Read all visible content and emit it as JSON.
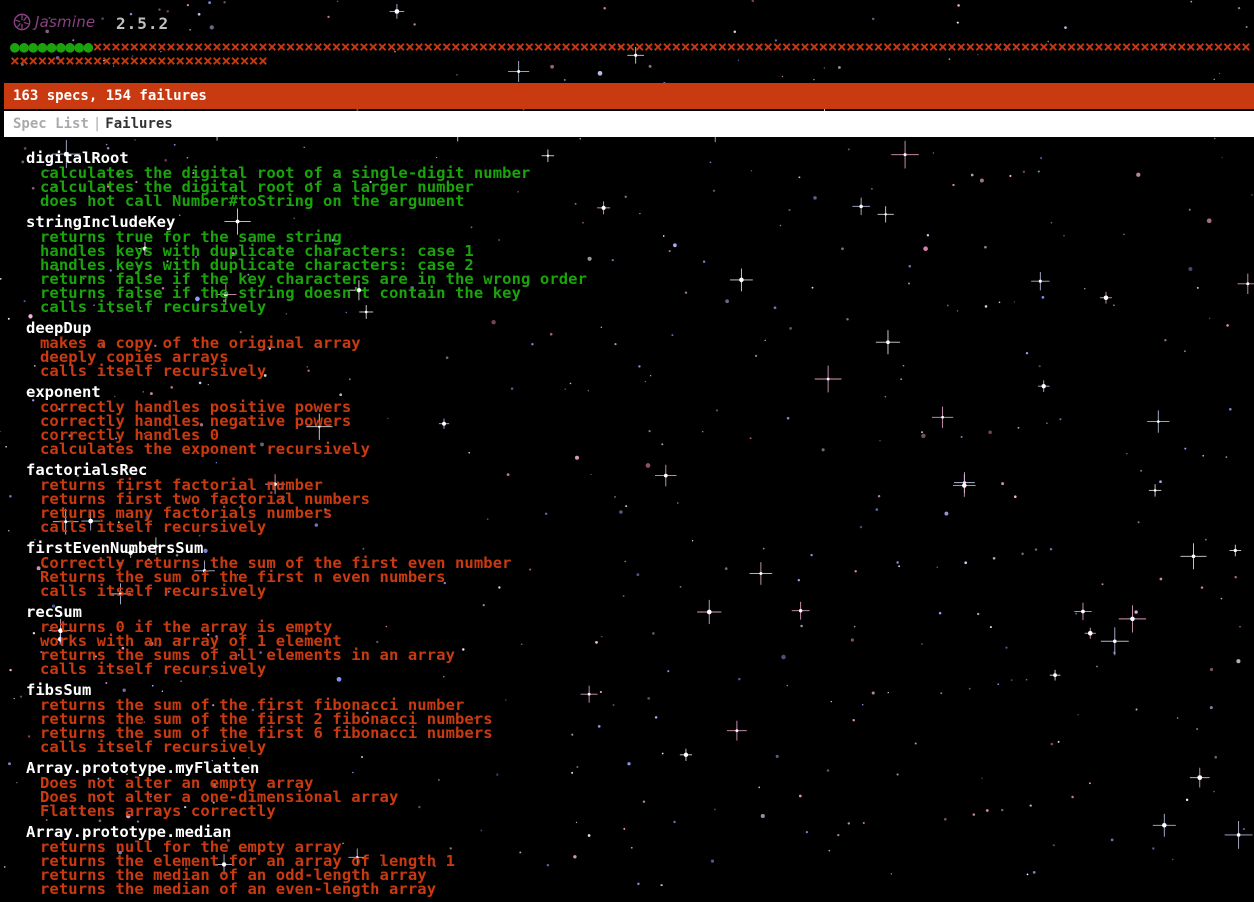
{
  "header": {
    "logo_text": "Jasmine",
    "version": "2.5.2"
  },
  "symbols": {
    "passed": 9,
    "failed": 154,
    "pass_glyph": "●",
    "fail_glyph": "×"
  },
  "summary": {
    "text": "163 specs, 154 failures"
  },
  "menu": {
    "spec_list": "Spec List",
    "separator": "|",
    "failures": "Failures"
  },
  "colors": {
    "passed": "#1aa30b",
    "failed": "#ca3a11",
    "suite": "#ffffff",
    "logo": "#8a4182"
  },
  "suites": [
    {
      "name": "digitalRoot",
      "specs": [
        {
          "text": "calculates the digital root of a single-digit number",
          "status": "passed"
        },
        {
          "text": "calculates the digital root of a larger number",
          "status": "passed"
        },
        {
          "text": "does not call Number#toString on the argument",
          "status": "passed"
        }
      ]
    },
    {
      "name": "stringIncludeKey",
      "specs": [
        {
          "text": "returns true for the same string",
          "status": "passed"
        },
        {
          "text": "handles keys with duplicate characters: case 1",
          "status": "passed"
        },
        {
          "text": "handles keys with duplicate characters: case 2",
          "status": "passed"
        },
        {
          "text": "returns false if the key characters are in the wrong order",
          "status": "passed"
        },
        {
          "text": "returns false if the string doesn't contain the key",
          "status": "passed"
        },
        {
          "text": "calls itself recursively",
          "status": "passed"
        }
      ]
    },
    {
      "name": "deepDup",
      "specs": [
        {
          "text": "makes a copy of the original array",
          "status": "failed"
        },
        {
          "text": "deeply copies arrays",
          "status": "failed"
        },
        {
          "text": "calls itself recursively",
          "status": "failed"
        }
      ]
    },
    {
      "name": "exponent",
      "specs": [
        {
          "text": "correctly handles positive powers",
          "status": "failed"
        },
        {
          "text": "correctly handles negative powers",
          "status": "failed"
        },
        {
          "text": "correctly handles 0",
          "status": "failed"
        },
        {
          "text": "calculates the exponent recursively",
          "status": "failed"
        }
      ]
    },
    {
      "name": "factorialsRec",
      "specs": [
        {
          "text": "returns first factorial number",
          "status": "failed"
        },
        {
          "text": "returns first two factorial numbers",
          "status": "failed"
        },
        {
          "text": "returns many factorials numbers",
          "status": "failed"
        },
        {
          "text": "calls itself recursively",
          "status": "failed"
        }
      ]
    },
    {
      "name": "firstEvenNumbersSum",
      "specs": [
        {
          "text": "Correctly returns the sum of the first even number",
          "status": "failed"
        },
        {
          "text": "Returns the sum of the first n even numbers",
          "status": "failed"
        },
        {
          "text": "calls itself recursively",
          "status": "failed"
        }
      ]
    },
    {
      "name": "recSum",
      "specs": [
        {
          "text": "returns 0 if the array is empty",
          "status": "failed"
        },
        {
          "text": "works with an array of 1 element",
          "status": "failed"
        },
        {
          "text": "returns the sums of all elements in an array",
          "status": "failed"
        },
        {
          "text": "calls itself recursively",
          "status": "failed"
        }
      ]
    },
    {
      "name": "fibsSum",
      "specs": [
        {
          "text": "returns the sum of the first fibonacci number",
          "status": "failed"
        },
        {
          "text": "returns the sum of the first 2 fibonacci numbers",
          "status": "failed"
        },
        {
          "text": "returns the sum of the first 6 fibonacci numbers",
          "status": "failed"
        },
        {
          "text": "calls itself recursively",
          "status": "failed"
        }
      ]
    },
    {
      "name": "Array.prototype.myFlatten",
      "specs": [
        {
          "text": "Does not alter an empty array",
          "status": "failed"
        },
        {
          "text": "Does not alter a one-dimensional array",
          "status": "failed"
        },
        {
          "text": "Flattens arrays correctly",
          "status": "failed"
        }
      ]
    },
    {
      "name": "Array.prototype.median",
      "specs": [
        {
          "text": "returns null for the empty array",
          "status": "failed"
        },
        {
          "text": "returns the element for an array of length 1",
          "status": "failed"
        },
        {
          "text": "returns the median of an odd-length array",
          "status": "failed"
        },
        {
          "text": "returns the median of an even-length array",
          "status": "failed"
        }
      ]
    }
  ]
}
